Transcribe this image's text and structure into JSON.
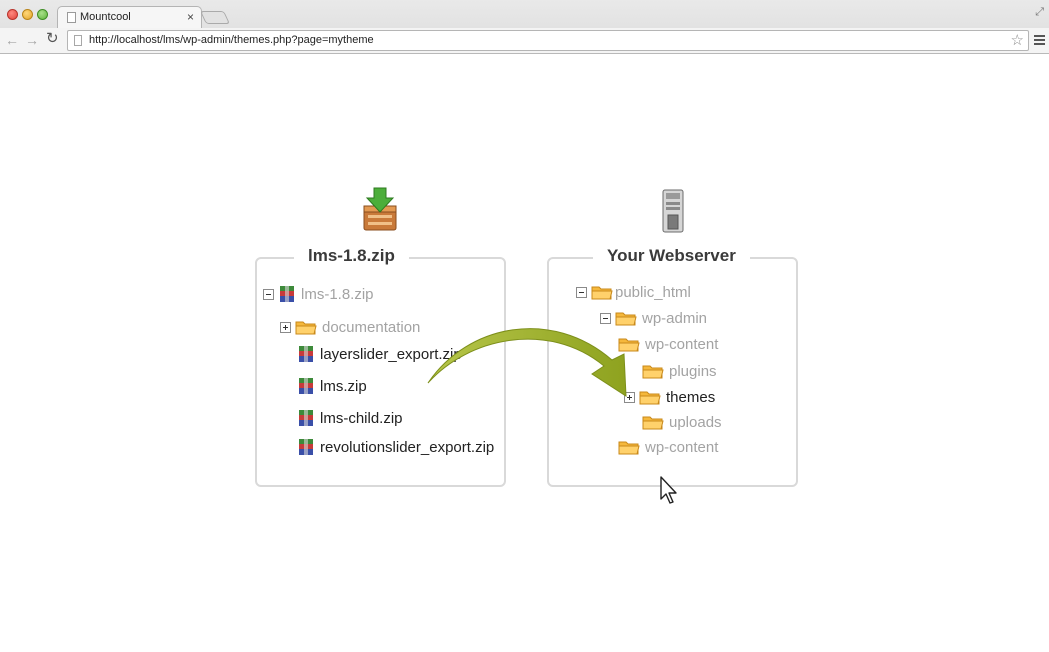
{
  "browser": {
    "tab_title": "Mountcool",
    "tab_close": "×",
    "url": "http://localhost/lms/wp-admin/themes.php?page=mytheme",
    "nav_back": "←",
    "nav_forward": "→",
    "nav_reload": "↻",
    "star": "☆"
  },
  "left_panel": {
    "title": "lms-1.8.zip",
    "icon": "archive-download-icon",
    "tree": [
      {
        "label": "lms-1.8.zip",
        "icon": "archive-icon",
        "toggle": "minus"
      },
      {
        "label": "documentation",
        "icon": "folder-icon",
        "toggle": "plus"
      },
      {
        "label": "layerslider_export.zip",
        "icon": "archive-icon"
      },
      {
        "label": "lms.zip",
        "icon": "archive-icon"
      },
      {
        "label": "lms-child.zip",
        "icon": "archive-icon"
      },
      {
        "label": "revolutionslider_export.zip",
        "icon": "archive-icon"
      }
    ]
  },
  "right_panel": {
    "title": "Your Webserver",
    "icon": "server-icon",
    "tree": [
      {
        "label": "public_html",
        "icon": "folder-icon",
        "toggle": "minus"
      },
      {
        "label": "wp-admin",
        "icon": "folder-icon",
        "toggle": "minus"
      },
      {
        "label": "wp-content",
        "icon": "folder-icon"
      },
      {
        "label": "plugins",
        "icon": "folder-icon"
      },
      {
        "label": "themes",
        "icon": "folder-icon",
        "toggle": "plus",
        "highlighted": true
      },
      {
        "label": "uploads",
        "icon": "folder-icon"
      },
      {
        "label": "wp-content",
        "icon": "folder-icon"
      }
    ]
  },
  "colors": {
    "arrow": "#9aad2a",
    "folder": "#f5b83c",
    "muted_text": "#a3a3a3",
    "panel_border": "#d9d9d9"
  }
}
